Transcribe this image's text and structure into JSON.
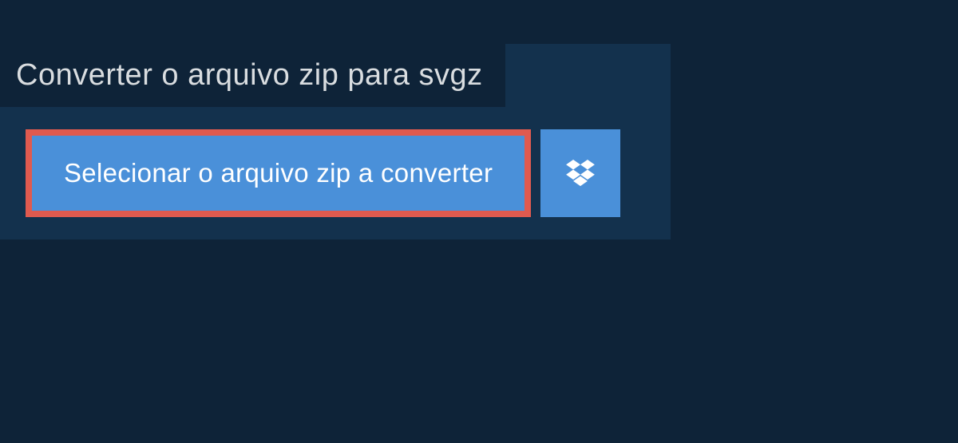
{
  "header": {
    "title": "Converter o arquivo zip para svgz"
  },
  "buttons": {
    "select_file_label": "Selecionar o arquivo zip a converter"
  },
  "colors": {
    "background": "#0e2338",
    "panel": "#13314d",
    "button_primary": "#4a90d9",
    "button_border_highlight": "#e05a4f",
    "text_light": "#d9dde0"
  }
}
